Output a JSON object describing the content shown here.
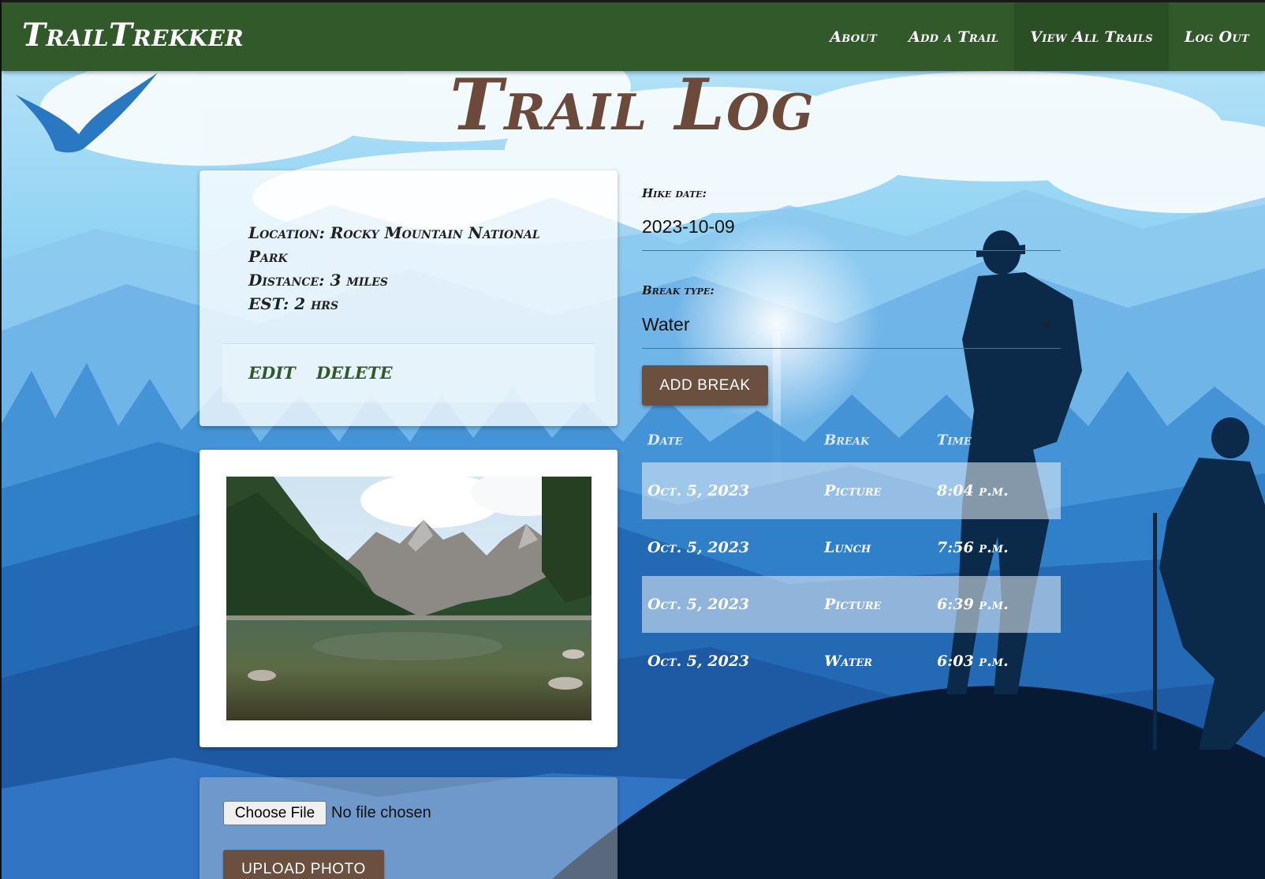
{
  "app": {
    "brand": "TrailTrekker"
  },
  "nav": [
    {
      "label": "About",
      "active": false
    },
    {
      "label": "Add a Trail",
      "active": false
    },
    {
      "label": "View All Trails",
      "active": true
    },
    {
      "label": "Log Out",
      "active": false
    }
  ],
  "page": {
    "title": "Trail Log"
  },
  "trail": {
    "location": "Location: Rocky Mountain National Park",
    "distance": "Distance: 3 miles",
    "est": "EST: 2 hrs",
    "edit_label": "EDIT",
    "delete_label": "DELETE"
  },
  "photo": {
    "alt": "Mountain lake photo"
  },
  "upload": {
    "choose_file_label": "Choose File",
    "no_file_text": "No file chosen",
    "upload_label": "UPLOAD PHOTO"
  },
  "form": {
    "hike_date_label": "Hike date:",
    "hike_date_value": "2023-10-09",
    "break_type_label": "Break type:",
    "break_type_value": "Water",
    "add_break_label": "ADD BREAK"
  },
  "table": {
    "headers": [
      "Date",
      "Break",
      "Time"
    ],
    "rows": [
      [
        "Oct. 5, 2023",
        "Picture",
        "8:04 p.m."
      ],
      [
        "Oct. 5, 2023",
        "Lunch",
        "7:56 p.m."
      ],
      [
        "Oct. 5, 2023",
        "Picture",
        "6:39 p.m."
      ],
      [
        "Oct. 5, 2023",
        "Water",
        "6:03 p.m."
      ]
    ]
  },
  "colors": {
    "navbar": "#31592a",
    "title": "#6b4a3c",
    "button": "#6b4f3f",
    "link": "#31592a"
  }
}
